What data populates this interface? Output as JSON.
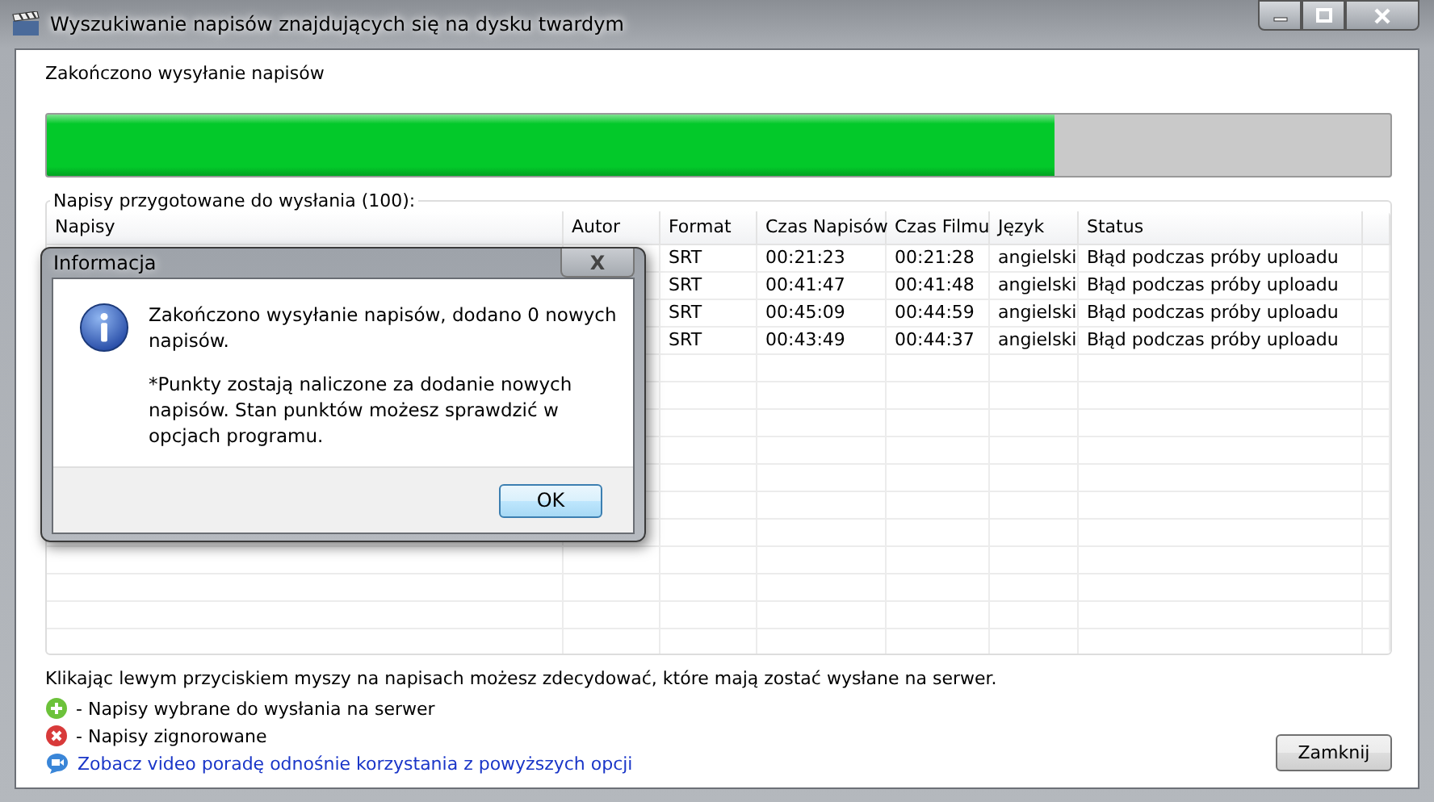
{
  "window": {
    "title": "Wyszukiwanie napisów znajdujących się na dysku twardym"
  },
  "status_text": "Zakończono wysyłanie napisów",
  "progress": {
    "level": 0.75
  },
  "group": {
    "title": "Napisy przygotowane do wysłania (100):"
  },
  "table": {
    "columns": [
      "Napisy",
      "Autor",
      "Format",
      "Czas Napisów",
      "Czas Filmu",
      "Język",
      "Status"
    ],
    "rows": [
      {
        "format": "SRT",
        "czas_napisow": "00:21:23",
        "czas_filmu": "00:21:28",
        "jezyk": "angielski",
        "status": "Błąd podczas próby uploadu"
      },
      {
        "format": "SRT",
        "czas_napisow": "00:41:47",
        "czas_filmu": "00:41:48",
        "jezyk": "angielski",
        "status": "Błąd podczas próby uploadu"
      },
      {
        "format": "SRT",
        "czas_napisow": "00:45:09",
        "czas_filmu": "00:44:59",
        "jezyk": "angielski",
        "status": "Błąd podczas próby uploadu"
      },
      {
        "format": "SRT",
        "czas_napisow": "00:43:49",
        "czas_filmu": "00:44:37",
        "jezyk": "angielski",
        "status": "Błąd podczas próby uploadu"
      }
    ]
  },
  "hint": "Klikając lewym przyciskiem myszy na napisach możesz zdecydować, które mają zostać wysłane na serwer.",
  "legend": [
    {
      "kind": "selected",
      "text": "- Napisy wybrane do wysłania na serwer"
    },
    {
      "kind": "ignored",
      "text": "- Napisy zignorowane"
    }
  ],
  "video_link": "Zobacz video poradę odnośnie korzystania z powyższych opcji",
  "close_button": "Zamknij",
  "dialog": {
    "title": "Informacja",
    "close": "X",
    "message": "Zakończono wysyłanie napisów, dodano 0 nowych napisów.",
    "note": "*Punkty zostają naliczone za dodanie nowych napisów. Stan punktów możesz sprawdzić w opcjach programu.",
    "ok": "OK"
  }
}
